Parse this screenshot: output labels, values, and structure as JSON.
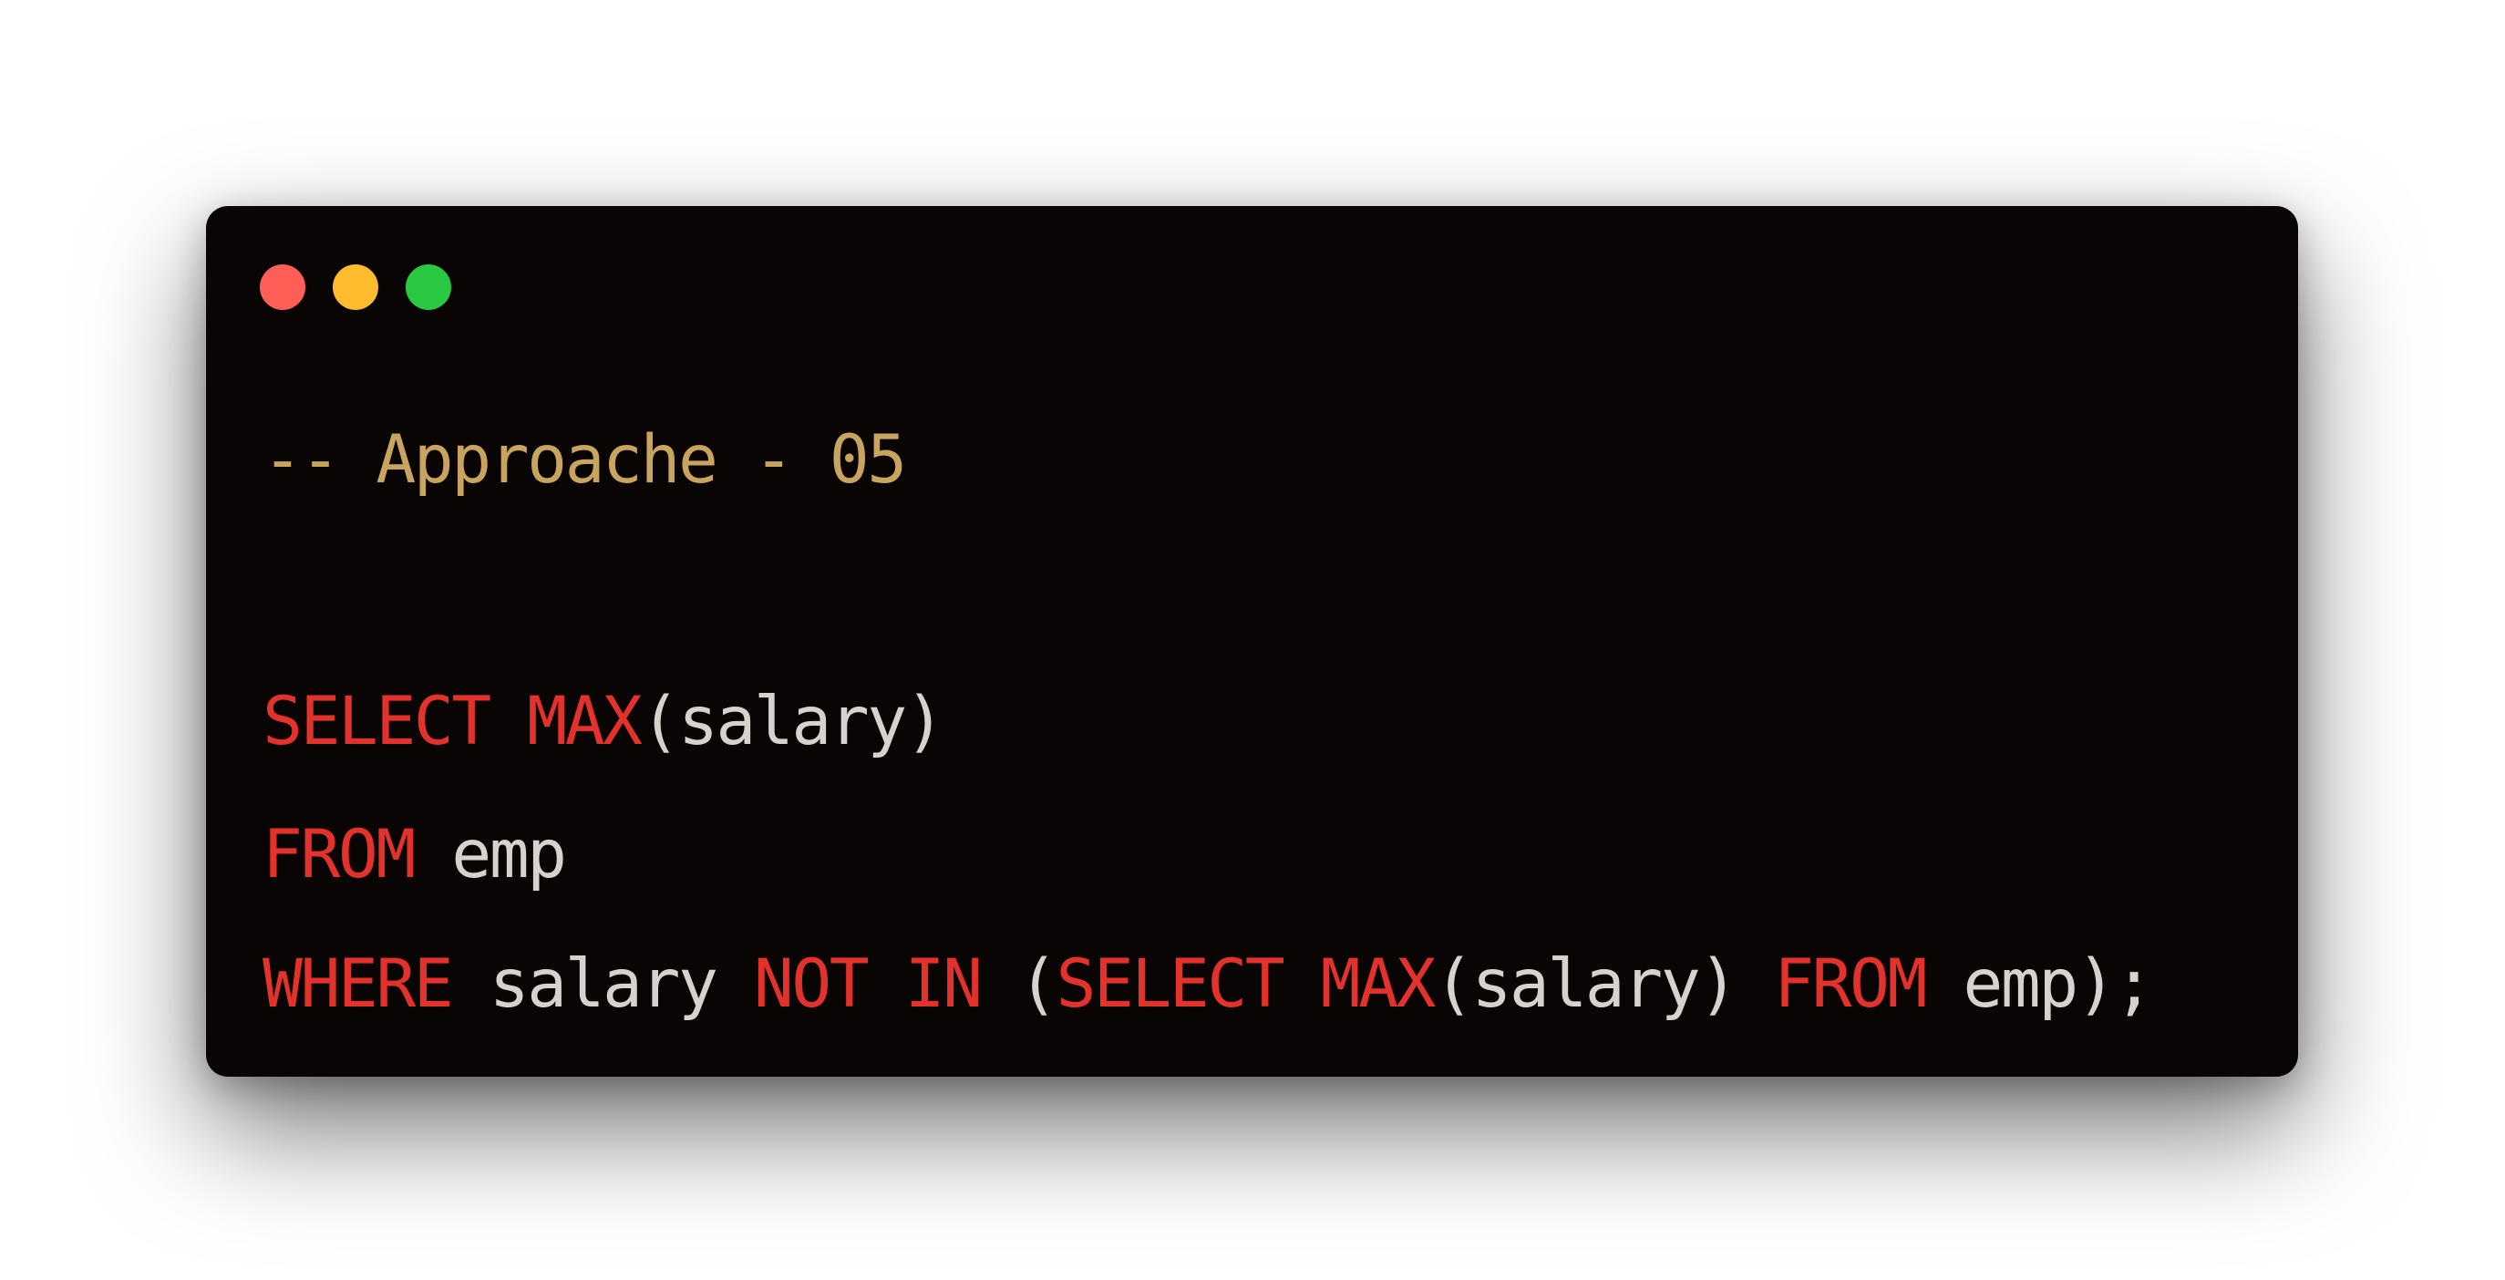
{
  "window": {
    "controls": [
      "close",
      "minimize",
      "maximize"
    ]
  },
  "code": {
    "comment": "-- Approache - 05",
    "line_select": {
      "kw_select": "SELECT",
      "fn_max": "MAX",
      "arg": "(salary)"
    },
    "line_from": {
      "kw_from": "FROM",
      "table": "emp"
    },
    "line_where": {
      "kw_where": "WHERE",
      "column": "salary",
      "kw_not": "NOT",
      "kw_in": "IN",
      "open_paren": "(",
      "kw_select": "SELECT",
      "fn_max": "MAX",
      "arg": "(salary)",
      "kw_from": "FROM",
      "tail": "emp);"
    }
  },
  "colors": {
    "window_bg": "#090504",
    "keyword": "#e2322b",
    "comment": "#c9a45f",
    "identifier": "#d7d2ce",
    "close_button": "#ff5f57",
    "minimize_button": "#febc2e",
    "maximize_button": "#28c840"
  }
}
